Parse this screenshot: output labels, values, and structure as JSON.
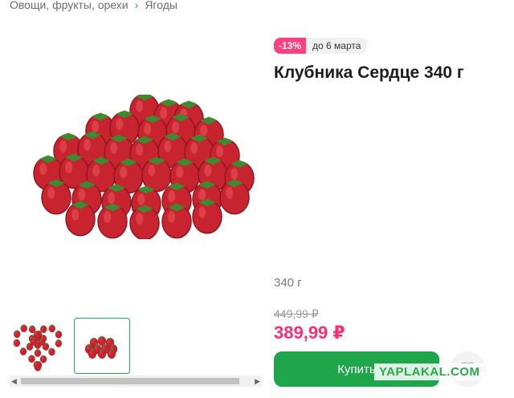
{
  "breadcrumb": {
    "items": [
      "Овощи, фрукты, орехи",
      "Ягоды"
    ]
  },
  "product": {
    "discount_badge": "-13%",
    "discount_until": "до 6 марта",
    "title": "Клубника Сердце 340 г",
    "weight": "340 г",
    "old_price": "449,99 ₽",
    "price": "389,99 ₽",
    "buy_label": "Купить"
  },
  "gallery": {
    "thumbnails": [
      "heart-strawberries",
      "strawberry-pile"
    ],
    "selected_index": 1
  },
  "watermark": "YAPLAKAL.COM",
  "colors": {
    "accent_green": "#1fa64a",
    "price_pink": "#ff2d74",
    "discount_pink": "#ff3f7e"
  }
}
